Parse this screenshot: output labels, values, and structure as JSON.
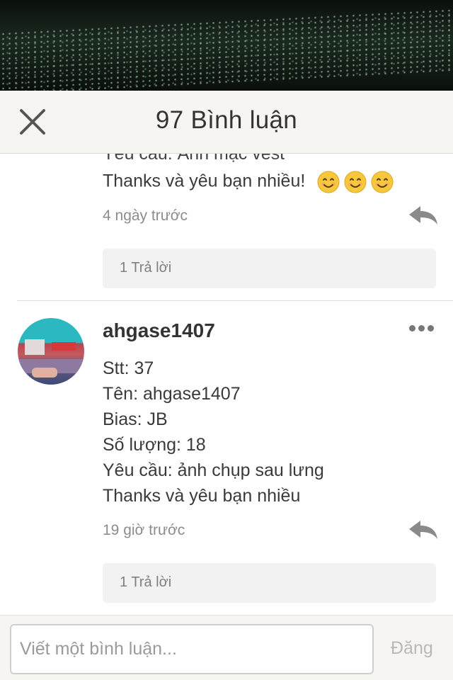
{
  "header": {
    "title": "97 Bình luận",
    "close_icon": "close-icon"
  },
  "comments": [
    {
      "cut_line": "Yêu cầu: Ảnh mặc vest",
      "last_line": "Thanks và yêu bạn nhiều!",
      "emojis": [
        "smiley-icon",
        "smiley-icon",
        "smiley-icon"
      ],
      "time": "4 ngày trước",
      "reply_count": "1 Trả lời"
    },
    {
      "username": "ahgase1407",
      "lines": [
        "Stt: 37",
        "Tên: ahgase1407",
        "Bias: JB",
        "Số lượng: 18",
        "Yêu cầu: ảnh chụp sau lưng",
        "Thanks và yêu bạn nhiều"
      ],
      "time": "19 giờ trước",
      "reply_count": "1 Trả lời"
    }
  ],
  "composer": {
    "placeholder": "Viết một bình luận...",
    "post_label": "Đăng"
  },
  "colors": {
    "header_bg": "#f6f5f2",
    "muted_text": "#8c8c8c",
    "reply_icon": "#8a8a8a",
    "emoji_fill": "#f7c83c"
  }
}
